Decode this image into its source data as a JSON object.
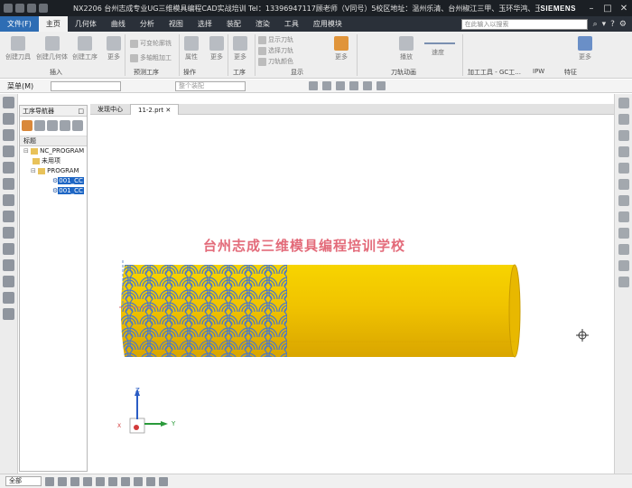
{
  "titlebar": {
    "title": "NX2206 台州志成专业UG三维模具编程CAD实战培训 Tel：13396947117顾老师（V同号）5校区地址：温州乐清、台州椒江三甲、玉环华鸿、玉环沙门、玉环坎门 - 加工",
    "brand": "SIEMENS"
  },
  "menubar": {
    "file_label": "文件(F)",
    "tabs": [
      "主页",
      "几何体",
      "曲线",
      "分析",
      "视图",
      "选择",
      "装配",
      "渲染",
      "工具",
      "应用模块"
    ],
    "search_placeholder": "在此输入以搜索"
  },
  "ribbon": {
    "items": {
      "create_tool": "创建刀具",
      "create_geometry": "创建几何体",
      "create_operation": "创建工序",
      "more_insert": "更多",
      "variable_contour": "可变轮廓铣",
      "multi_axis": "多轴粗加工",
      "attribute": "属性",
      "more_op": "更多",
      "more_process": "更多",
      "show_tool": "显示刀轨",
      "select_tool": "选择刀轨",
      "tool_path_reset": "刀轨颜色",
      "more_display": "更多",
      "play": "播放",
      "speed": "速度",
      "more_end": "更多"
    },
    "groups": [
      "插入",
      "预测工序",
      "操作",
      "工序",
      "显示",
      "刀轨动画",
      "加工工具 - GC工...",
      "IPW",
      "特征"
    ]
  },
  "toolrow": {
    "menu_label": "菜单(M)",
    "filter_placeholder": "",
    "assembly_placeholder": "整个装配"
  },
  "navigator": {
    "title": "工序导航器",
    "column_header": "标题",
    "tree": [
      {
        "label": "NC_PROGRAM",
        "indent": 0,
        "selected": false
      },
      {
        "label": "未用项",
        "indent": 1,
        "selected": false
      },
      {
        "label": "PROGRAM",
        "indent": 1,
        "selected": false
      },
      {
        "label": "001_CC",
        "indent": 2,
        "selected": true
      },
      {
        "label": "001_CC",
        "indent": 2,
        "selected": true
      }
    ]
  },
  "doc_tabs": [
    "发现中心",
    "11-2.prt"
  ],
  "viewport": {
    "watermark": "台州志成三维模具编程培训学校",
    "axis_x": "X",
    "axis_y": "Y",
    "axis_z": "Z",
    "cylinder_color": "#f2c200",
    "pattern_color": "#4a78c8"
  },
  "statusbar": {
    "filter_value": "全部"
  }
}
